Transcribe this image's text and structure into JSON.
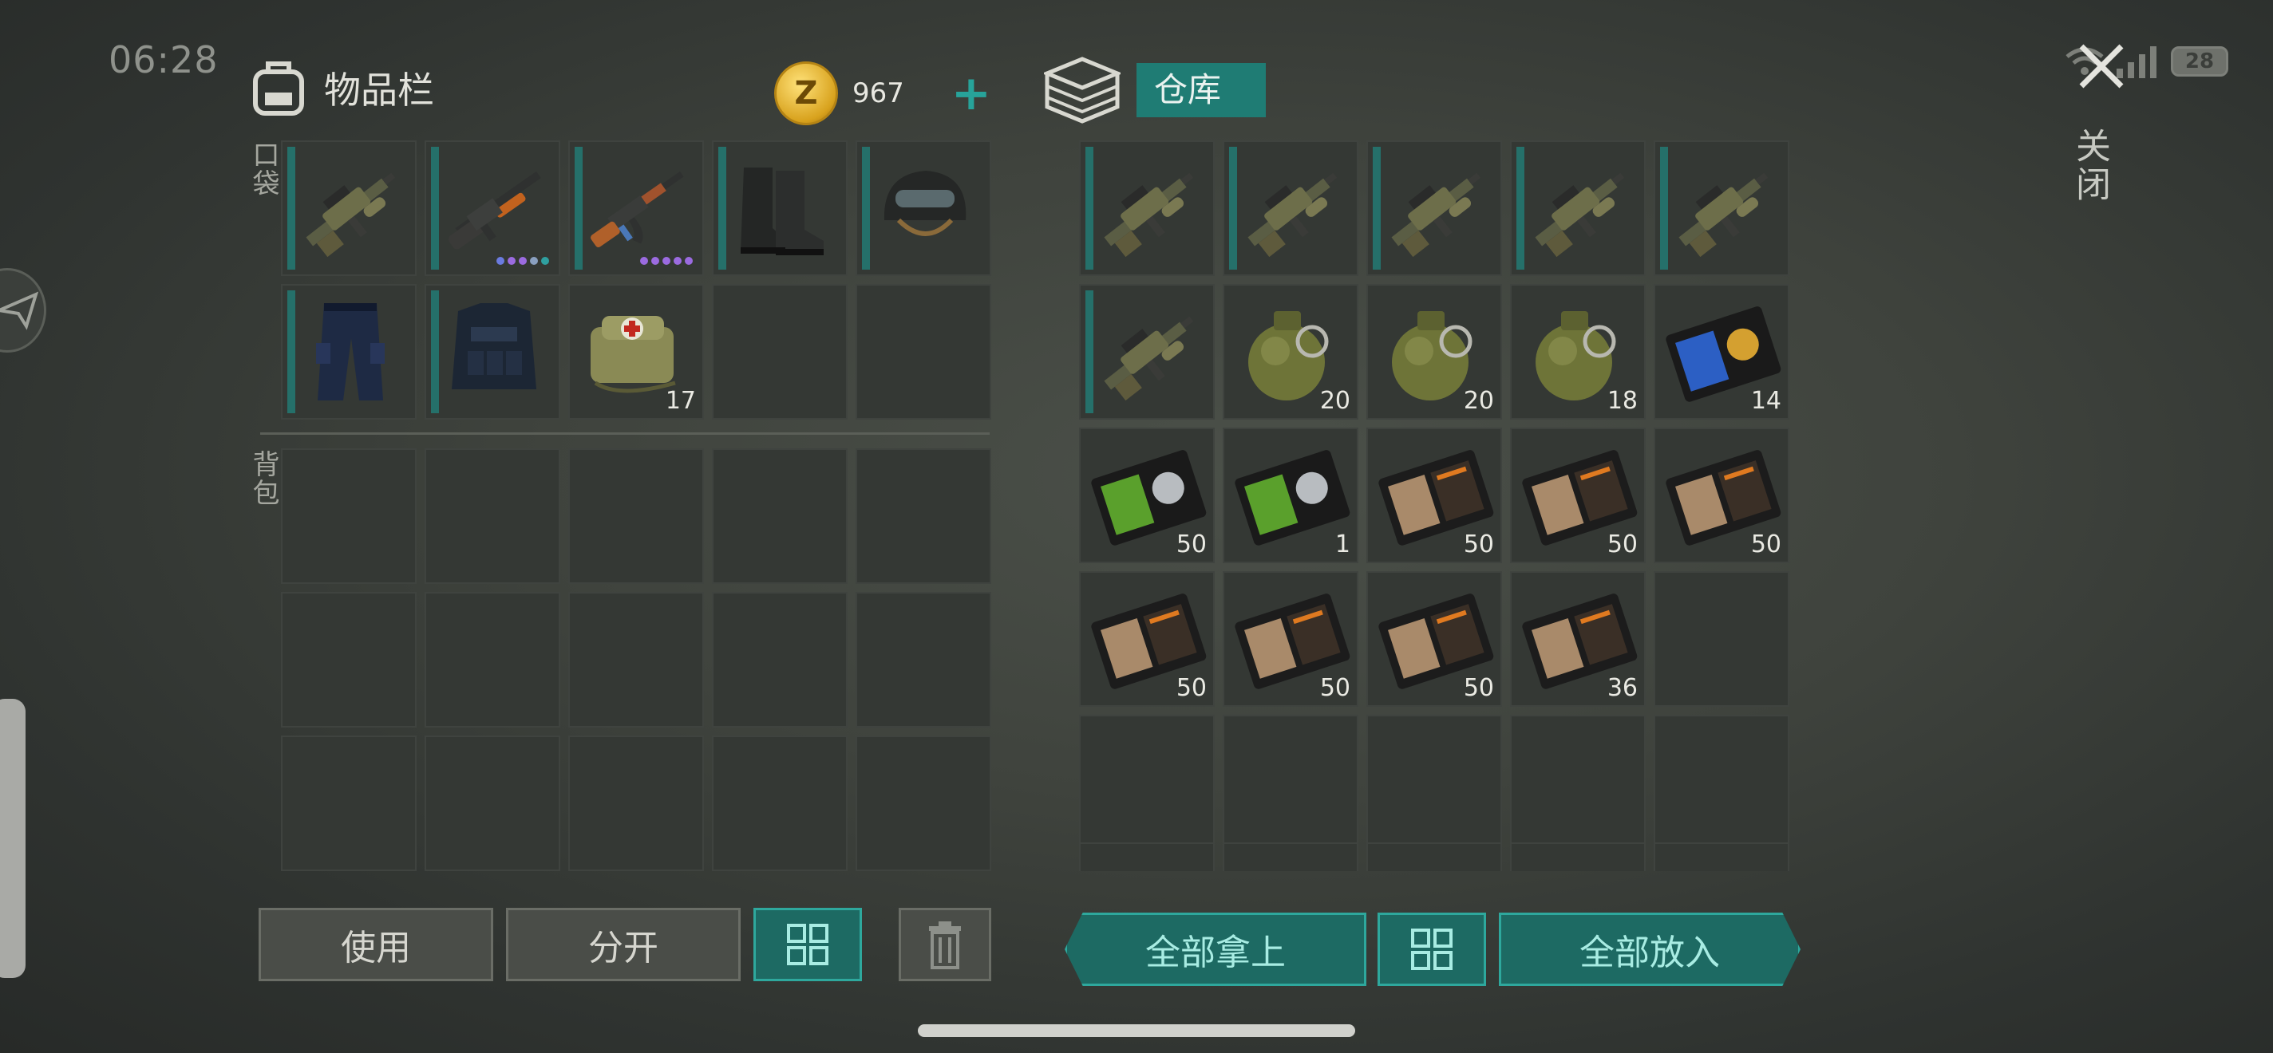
{
  "status": {
    "time": "06:28",
    "battery": "28"
  },
  "close_label": "关闭",
  "inventory": {
    "title": "物品栏",
    "coins": "967",
    "pocket_label": "口袋",
    "backpack_label": "背包",
    "pocket": [
      {
        "item": "grenade-launcher-rifle-icon",
        "qty": "",
        "equipped": true,
        "dots": []
      },
      {
        "item": "shotgun-icon",
        "qty": "",
        "equipped": true,
        "dots": [
          "#6b7be0",
          "#9b6be0",
          "#9b6be0",
          "#8aa0c0",
          "#2fa0a0"
        ]
      },
      {
        "item": "assault-rifle-icon",
        "qty": "",
        "equipped": true,
        "dots": [
          "#9b6be0",
          "#9b6be0",
          "#9b6be0",
          "#9b6be0",
          "#9b6be0"
        ]
      },
      {
        "item": "boots-icon",
        "qty": "",
        "equipped": true,
        "dots": []
      },
      {
        "item": "helmet-icon",
        "qty": "",
        "equipped": true,
        "dots": []
      },
      {
        "item": "pants-icon",
        "qty": "",
        "equipped": true,
        "dots": []
      },
      {
        "item": "vest-icon",
        "qty": "",
        "equipped": true,
        "dots": []
      },
      {
        "item": "medkit-icon",
        "qty": "17",
        "equipped": false,
        "dots": []
      },
      {
        "item": "",
        "qty": "",
        "equipped": false,
        "dots": []
      },
      {
        "item": "",
        "qty": "",
        "equipped": false,
        "dots": []
      }
    ],
    "backpack_slots": 15,
    "buttons": {
      "use": "使用",
      "split": "分开"
    }
  },
  "warehouse": {
    "title": "仓库",
    "items": [
      {
        "item": "grenade-launcher-rifle-icon",
        "qty": "",
        "equipped": true
      },
      {
        "item": "grenade-launcher-rifle-icon",
        "qty": "",
        "equipped": true
      },
      {
        "item": "grenade-launcher-rifle-icon",
        "qty": "",
        "equipped": true
      },
      {
        "item": "grenade-launcher-rifle-icon",
        "qty": "",
        "equipped": true
      },
      {
        "item": "grenade-launcher-rifle-icon",
        "qty": "",
        "equipped": true
      },
      {
        "item": "grenade-launcher-rifle-icon",
        "qty": "",
        "equipped": true
      },
      {
        "item": "frag-grenade-icon",
        "qty": "20",
        "equipped": false
      },
      {
        "item": "frag-grenade-icon",
        "qty": "20",
        "equipped": false
      },
      {
        "item": "frag-grenade-icon",
        "qty": "18",
        "equipped": false
      },
      {
        "item": "blue-id-badge-icon",
        "qty": "14",
        "equipped": false
      },
      {
        "item": "green-id-badge-icon",
        "qty": "50",
        "equipped": false
      },
      {
        "item": "green-id-badge-icon",
        "qty": "1",
        "equipped": false
      },
      {
        "item": "patrol-officer-id-icon",
        "qty": "50",
        "equipped": false
      },
      {
        "item": "patrol-officer-id-icon",
        "qty": "50",
        "equipped": false
      },
      {
        "item": "patrol-officer-id-icon",
        "qty": "50",
        "equipped": false
      },
      {
        "item": "patrol-officer-id-icon",
        "qty": "50",
        "equipped": false
      },
      {
        "item": "patrol-officer-id-icon",
        "qty": "50",
        "equipped": false
      },
      {
        "item": "patrol-officer-id-icon",
        "qty": "50",
        "equipped": false
      },
      {
        "item": "patrol-officer-id-icon",
        "qty": "36",
        "equipped": false
      },
      {
        "item": "",
        "qty": "",
        "equipped": false
      },
      {
        "item": "",
        "qty": "",
        "equipped": false
      },
      {
        "item": "",
        "qty": "",
        "equipped": false
      },
      {
        "item": "",
        "qty": "",
        "equipped": false
      },
      {
        "item": "",
        "qty": "",
        "equipped": false
      },
      {
        "item": "",
        "qty": "",
        "equipped": false
      }
    ],
    "buttons": {
      "take_all": "全部拿上",
      "put_all": "全部放入"
    }
  }
}
